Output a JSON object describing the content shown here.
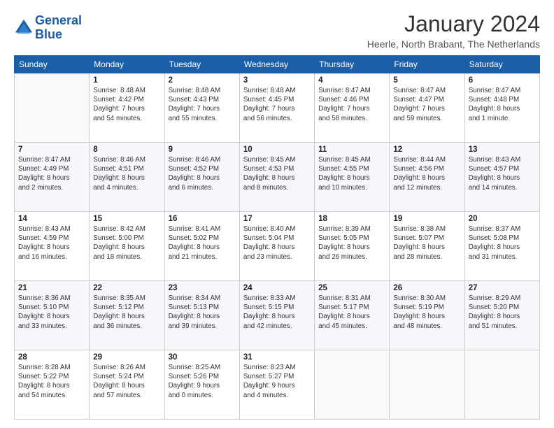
{
  "logo": {
    "line1": "General",
    "line2": "Blue"
  },
  "header": {
    "month": "January 2024",
    "location": "Heerle, North Brabant, The Netherlands"
  },
  "days_of_week": [
    "Sunday",
    "Monday",
    "Tuesday",
    "Wednesday",
    "Thursday",
    "Friday",
    "Saturday"
  ],
  "weeks": [
    [
      {
        "day": "",
        "info": ""
      },
      {
        "day": "1",
        "info": "Sunrise: 8:48 AM\nSunset: 4:42 PM\nDaylight: 7 hours\nand 54 minutes."
      },
      {
        "day": "2",
        "info": "Sunrise: 8:48 AM\nSunset: 4:43 PM\nDaylight: 7 hours\nand 55 minutes."
      },
      {
        "day": "3",
        "info": "Sunrise: 8:48 AM\nSunset: 4:45 PM\nDaylight: 7 hours\nand 56 minutes."
      },
      {
        "day": "4",
        "info": "Sunrise: 8:47 AM\nSunset: 4:46 PM\nDaylight: 7 hours\nand 58 minutes."
      },
      {
        "day": "5",
        "info": "Sunrise: 8:47 AM\nSunset: 4:47 PM\nDaylight: 7 hours\nand 59 minutes."
      },
      {
        "day": "6",
        "info": "Sunrise: 8:47 AM\nSunset: 4:48 PM\nDaylight: 8 hours\nand 1 minute."
      }
    ],
    [
      {
        "day": "7",
        "info": "Sunrise: 8:47 AM\nSunset: 4:49 PM\nDaylight: 8 hours\nand 2 minutes."
      },
      {
        "day": "8",
        "info": "Sunrise: 8:46 AM\nSunset: 4:51 PM\nDaylight: 8 hours\nand 4 minutes."
      },
      {
        "day": "9",
        "info": "Sunrise: 8:46 AM\nSunset: 4:52 PM\nDaylight: 8 hours\nand 6 minutes."
      },
      {
        "day": "10",
        "info": "Sunrise: 8:45 AM\nSunset: 4:53 PM\nDaylight: 8 hours\nand 8 minutes."
      },
      {
        "day": "11",
        "info": "Sunrise: 8:45 AM\nSunset: 4:55 PM\nDaylight: 8 hours\nand 10 minutes."
      },
      {
        "day": "12",
        "info": "Sunrise: 8:44 AM\nSunset: 4:56 PM\nDaylight: 8 hours\nand 12 minutes."
      },
      {
        "day": "13",
        "info": "Sunrise: 8:43 AM\nSunset: 4:57 PM\nDaylight: 8 hours\nand 14 minutes."
      }
    ],
    [
      {
        "day": "14",
        "info": "Sunrise: 8:43 AM\nSunset: 4:59 PM\nDaylight: 8 hours\nand 16 minutes."
      },
      {
        "day": "15",
        "info": "Sunrise: 8:42 AM\nSunset: 5:00 PM\nDaylight: 8 hours\nand 18 minutes."
      },
      {
        "day": "16",
        "info": "Sunrise: 8:41 AM\nSunset: 5:02 PM\nDaylight: 8 hours\nand 21 minutes."
      },
      {
        "day": "17",
        "info": "Sunrise: 8:40 AM\nSunset: 5:04 PM\nDaylight: 8 hours\nand 23 minutes."
      },
      {
        "day": "18",
        "info": "Sunrise: 8:39 AM\nSunset: 5:05 PM\nDaylight: 8 hours\nand 26 minutes."
      },
      {
        "day": "19",
        "info": "Sunrise: 8:38 AM\nSunset: 5:07 PM\nDaylight: 8 hours\nand 28 minutes."
      },
      {
        "day": "20",
        "info": "Sunrise: 8:37 AM\nSunset: 5:08 PM\nDaylight: 8 hours\nand 31 minutes."
      }
    ],
    [
      {
        "day": "21",
        "info": "Sunrise: 8:36 AM\nSunset: 5:10 PM\nDaylight: 8 hours\nand 33 minutes."
      },
      {
        "day": "22",
        "info": "Sunrise: 8:35 AM\nSunset: 5:12 PM\nDaylight: 8 hours\nand 36 minutes."
      },
      {
        "day": "23",
        "info": "Sunrise: 8:34 AM\nSunset: 5:13 PM\nDaylight: 8 hours\nand 39 minutes."
      },
      {
        "day": "24",
        "info": "Sunrise: 8:33 AM\nSunset: 5:15 PM\nDaylight: 8 hours\nand 42 minutes."
      },
      {
        "day": "25",
        "info": "Sunrise: 8:31 AM\nSunset: 5:17 PM\nDaylight: 8 hours\nand 45 minutes."
      },
      {
        "day": "26",
        "info": "Sunrise: 8:30 AM\nSunset: 5:19 PM\nDaylight: 8 hours\nand 48 minutes."
      },
      {
        "day": "27",
        "info": "Sunrise: 8:29 AM\nSunset: 5:20 PM\nDaylight: 8 hours\nand 51 minutes."
      }
    ],
    [
      {
        "day": "28",
        "info": "Sunrise: 8:28 AM\nSunset: 5:22 PM\nDaylight: 8 hours\nand 54 minutes."
      },
      {
        "day": "29",
        "info": "Sunrise: 8:26 AM\nSunset: 5:24 PM\nDaylight: 8 hours\nand 57 minutes."
      },
      {
        "day": "30",
        "info": "Sunrise: 8:25 AM\nSunset: 5:26 PM\nDaylight: 9 hours\nand 0 minutes."
      },
      {
        "day": "31",
        "info": "Sunrise: 8:23 AM\nSunset: 5:27 PM\nDaylight: 9 hours\nand 4 minutes."
      },
      {
        "day": "",
        "info": ""
      },
      {
        "day": "",
        "info": ""
      },
      {
        "day": "",
        "info": ""
      }
    ]
  ]
}
